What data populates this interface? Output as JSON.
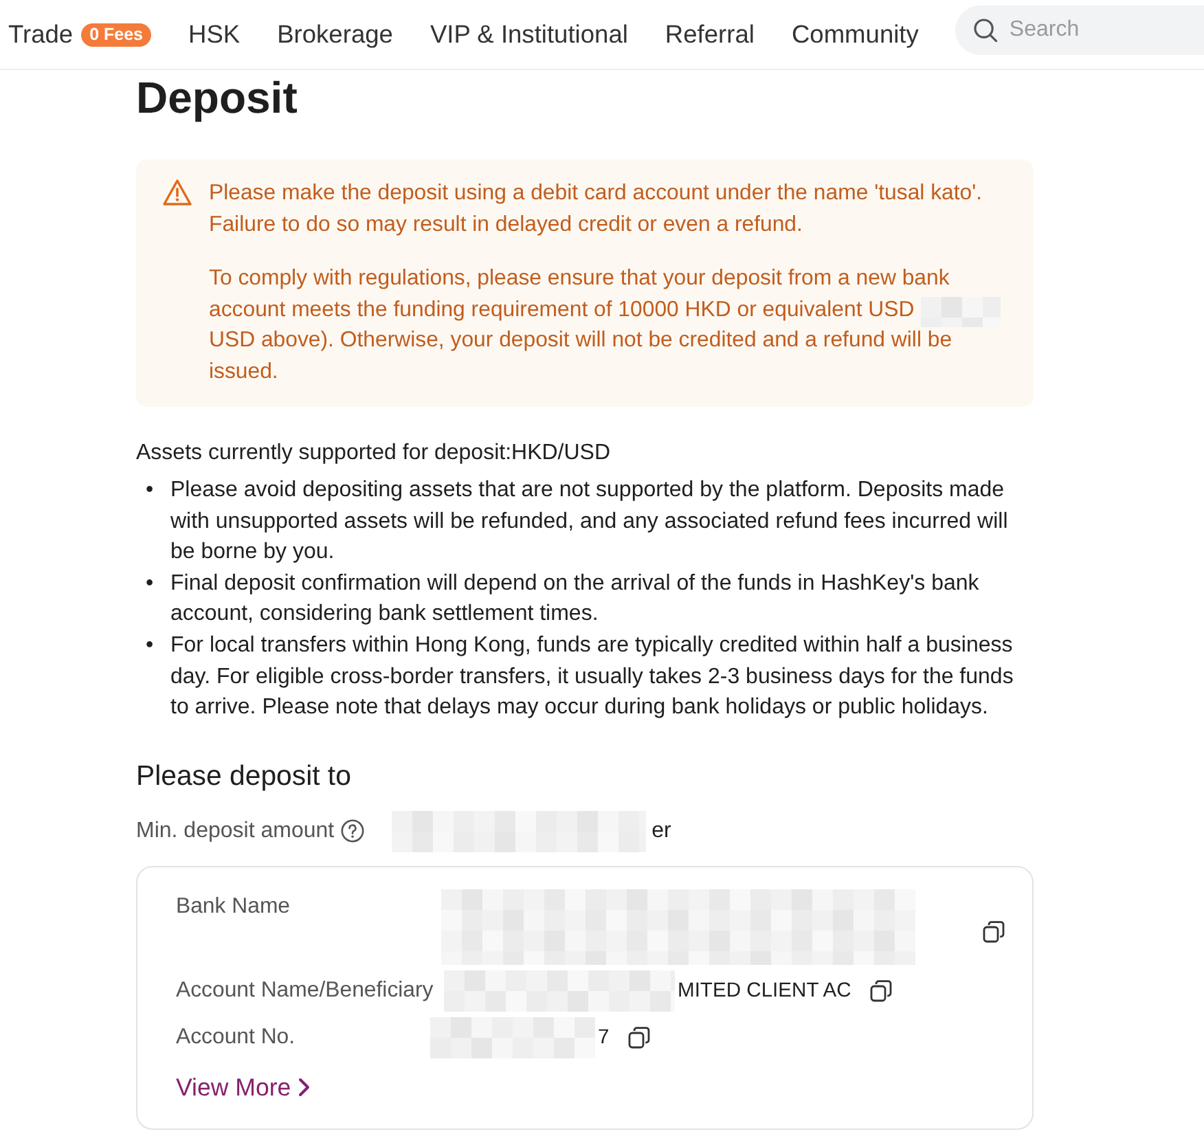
{
  "nav": {
    "items": [
      {
        "label": "Trade",
        "badge": "0 Fees"
      },
      {
        "label": "HSK"
      },
      {
        "label": "Brokerage"
      },
      {
        "label": "VIP & Institutional"
      },
      {
        "label": "Referral"
      },
      {
        "label": "Community"
      }
    ],
    "search": {
      "placeholder": "Search"
    }
  },
  "page": {
    "title": "Deposit"
  },
  "notice": {
    "paragraphs": [
      {
        "parts": [
          {
            "kind": "text",
            "text": "Please make the deposit using a debit card account under the name 'tusal kato'. Failure to do so may result in delayed credit or even a refund."
          }
        ]
      },
      {
        "parts": [
          {
            "kind": "text",
            "text": "To comply with regulations, please ensure that your deposit from a new bank account meets the funding requirement of 10000 HKD or equivalent USD"
          },
          {
            "kind": "redacted"
          },
          {
            "kind": "text",
            "text": "USD above). Otherwise, your deposit will not be credited and a refund will be issued."
          }
        ]
      }
    ]
  },
  "assets": {
    "heading": "Assets currently supported for deposit:HKD/USD",
    "notes": [
      {
        "bullet": "•",
        "text": "Please avoid depositing assets that are not supported by the platform. Deposits made with unsupported assets will be refunded, and any associated refund fees incurred will be borne by you."
      },
      {
        "bullet": "•",
        "text": "Final deposit confirmation will depend on the arrival of the funds in HashKey's bank account, considering bank settlement times."
      },
      {
        "bullet": "•",
        "text": "For local transfers within Hong Kong, funds are typically credited within half a business day. For eligible cross-border transfers, it usually takes 2-3 business days for the funds to arrive. Please note that delays may occur during bank holidays or public holidays."
      }
    ]
  },
  "deposit_to": {
    "title": "Please deposit to",
    "min_deposit": {
      "label": "Min. deposit amount",
      "value_parts": [
        {
          "kind": "redacted"
        },
        {
          "kind": "text",
          "text": "er"
        }
      ]
    },
    "fields": [
      {
        "label": "Bank Name",
        "value_parts": [
          {
            "kind": "redacted"
          }
        ],
        "copyable": true
      },
      {
        "label": "Account Name/Beneficiary",
        "value_parts": [
          {
            "kind": "redacted"
          },
          {
            "kind": "text",
            "text": "MITED CLIENT AC"
          }
        ],
        "copyable": true
      },
      {
        "label": "Account No.",
        "value_parts": [
          {
            "kind": "redacted"
          },
          {
            "kind": "text",
            "text": "7"
          }
        ],
        "copyable": true
      }
    ],
    "view_more": "View More"
  }
}
